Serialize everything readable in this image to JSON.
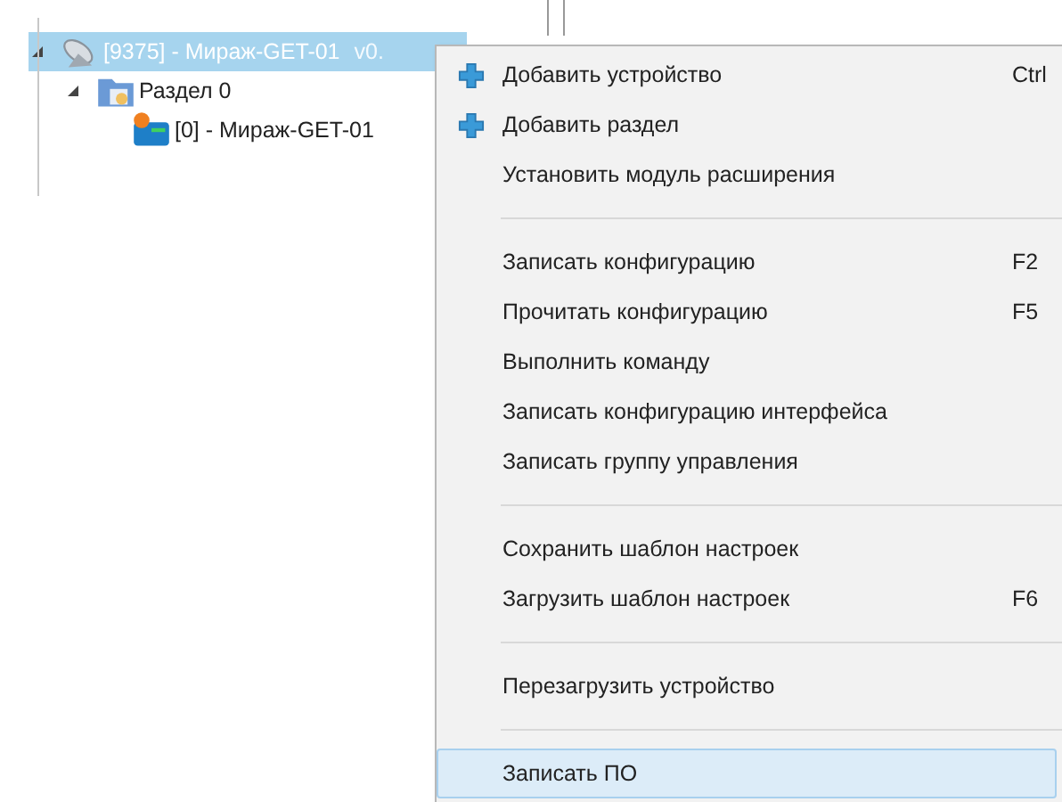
{
  "tree": [
    {
      "label": "[9375] - Мираж-GET-01",
      "version": "v0.",
      "expanded": true,
      "selected": true,
      "children": [
        {
          "label": "Раздел 0",
          "expanded": true,
          "selected": false,
          "children": [
            {
              "label": "[0] - Мираж-GET-01",
              "selected": false
            }
          ]
        }
      ]
    }
  ],
  "context_menu": {
    "items": [
      {
        "kind": "icon-item",
        "label": "Добавить устройство",
        "shortcut": "Ctrl",
        "selected": false
      },
      {
        "kind": "icon-item",
        "label": "Добавить раздел",
        "selected": false
      },
      {
        "kind": "item",
        "label": "Установить модуль расширения",
        "selected": false
      },
      {
        "kind": "separator"
      },
      {
        "kind": "item",
        "label": "Записать конфигурацию",
        "shortcut": "F2",
        "selected": false
      },
      {
        "kind": "item",
        "label": "Прочитать конфигурацию",
        "shortcut": "F5",
        "selected": false
      },
      {
        "kind": "item",
        "label": "Выполнить команду",
        "selected": false
      },
      {
        "kind": "item",
        "label": "Записать конфигурацию интерфейса",
        "selected": false
      },
      {
        "kind": "item",
        "label": "Записать группу управления",
        "selected": false
      },
      {
        "kind": "separator"
      },
      {
        "kind": "item",
        "label": "Сохранить шаблон настроек",
        "selected": false
      },
      {
        "kind": "item",
        "label": "Загрузить шаблон настроек",
        "shortcut": "F6",
        "selected": false
      },
      {
        "kind": "separator"
      },
      {
        "kind": "item",
        "label": "Перезагрузить устройство",
        "selected": false
      },
      {
        "kind": "separator"
      },
      {
        "kind": "item",
        "label": "Записать ПО",
        "selected": true
      }
    ]
  }
}
